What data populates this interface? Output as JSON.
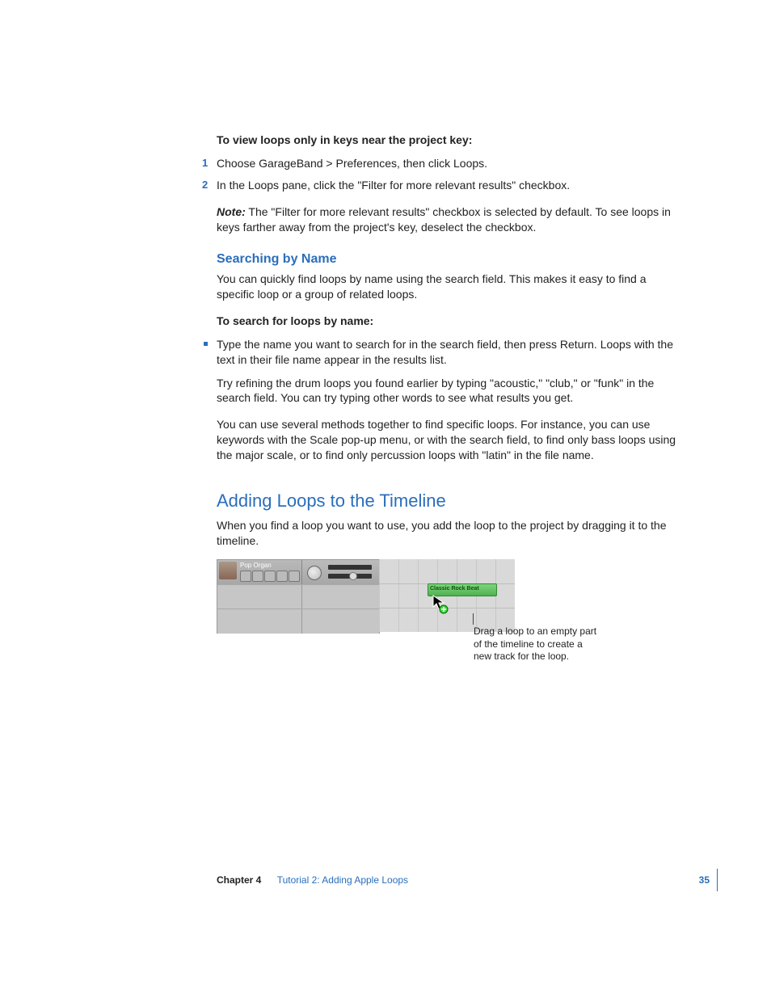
{
  "section1": {
    "heading_bold": "To view loops only in keys near the project key:",
    "steps": [
      "Choose GarageBand > Preferences, then click Loops.",
      "In the Loops pane, click the \"Filter for more relevant results\" checkbox."
    ],
    "note_lead": "Note:",
    "note_body": "The \"Filter for more relevant results\" checkbox is selected by default. To see loops in keys farther away from the project's key, deselect the checkbox."
  },
  "section2": {
    "heading": "Searching by Name",
    "intro": "You can quickly find loops by name using the search field. This makes it easy to find a specific loop or a group of related loops.",
    "sub_bold": "To search for loops by name:",
    "bullet": "Type the name you want to search for in the search field, then press Return. Loops with the text in their file name appear in the results list.",
    "para1": "Try refining the drum loops you found earlier by typing \"acoustic,\" \"club,\" or \"funk\" in the search field. You can try typing other words to see what results you get.",
    "para2": "You can use several methods together to find specific loops. For instance, you can use keywords with the Scale pop-up menu, or with the search field, to find only bass loops using the major scale, or to find only percussion loops with \"latin\" in the file name."
  },
  "section3": {
    "heading": "Adding Loops to the Timeline",
    "intro": "When you find a loop you want to use, you add the loop to the project by dragging it to the timeline.",
    "figure": {
      "track_name": "Pop Organ",
      "loop_chip": "Classic Rock Beat"
    },
    "callout": "Drag a loop to an empty part of the timeline to create a new track for the loop."
  },
  "footer": {
    "chapter": "Chapter 4",
    "tutorial": "Tutorial 2:  Adding Apple Loops",
    "page": "35"
  }
}
